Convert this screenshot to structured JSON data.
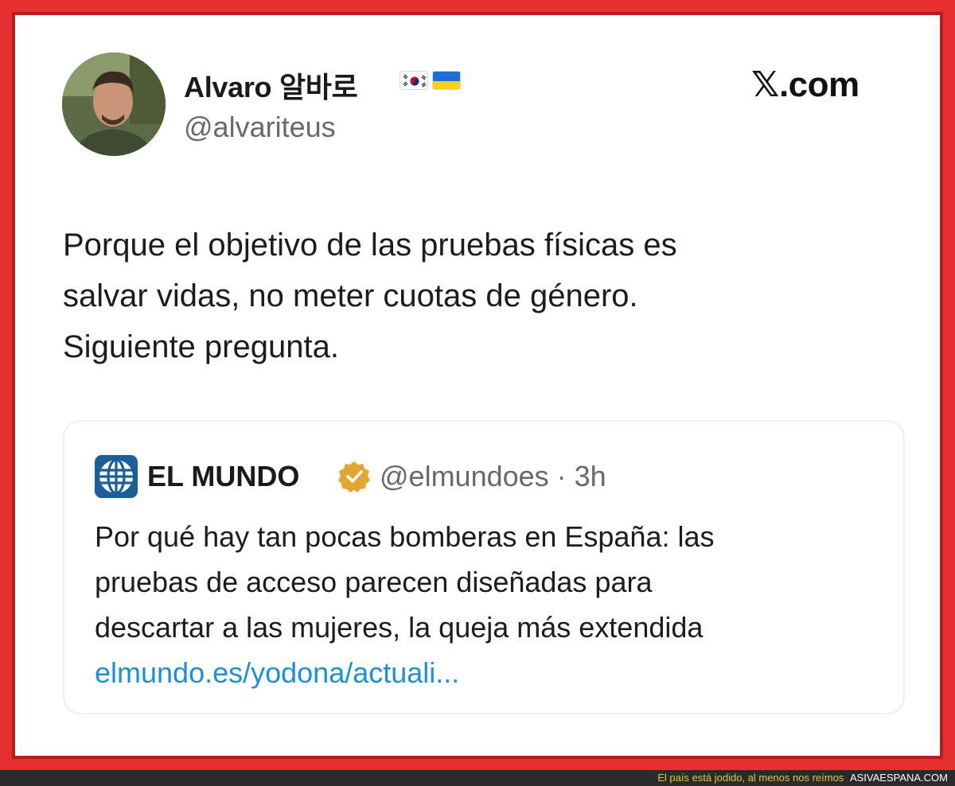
{
  "author": {
    "display_name": "Alvaro 알바로",
    "handle": "@alvariteus",
    "flags": [
      "korea-flag-icon",
      "ukraine-flag-icon"
    ]
  },
  "brand": "𝕏.com",
  "tweet": {
    "lines": [
      "Porque el objetivo de las pruebas físicas es",
      "salvar vidas, no meter cuotas de género.",
      "Siguiente pregunta."
    ]
  },
  "quoted": {
    "name": "EL MUNDO",
    "handle_time": "@elmundoes · 3h",
    "lines": [
      "Por qué hay tan pocas bomberas en España: las",
      "pruebas de acceso parecen diseñadas para",
      "descartar a las mujeres, la queja más extendida"
    ],
    "link": "elmundo.es/yodona/actuali..."
  },
  "footer": {
    "tagline": "El país está jodido, al menos nos reímos",
    "site": "ASIVAESPANA.COM"
  },
  "colors": {
    "frame": "#e5302f",
    "link": "#1d8fd6",
    "verified": "#e2a730",
    "elmundo_blue": "#1b5f99"
  }
}
